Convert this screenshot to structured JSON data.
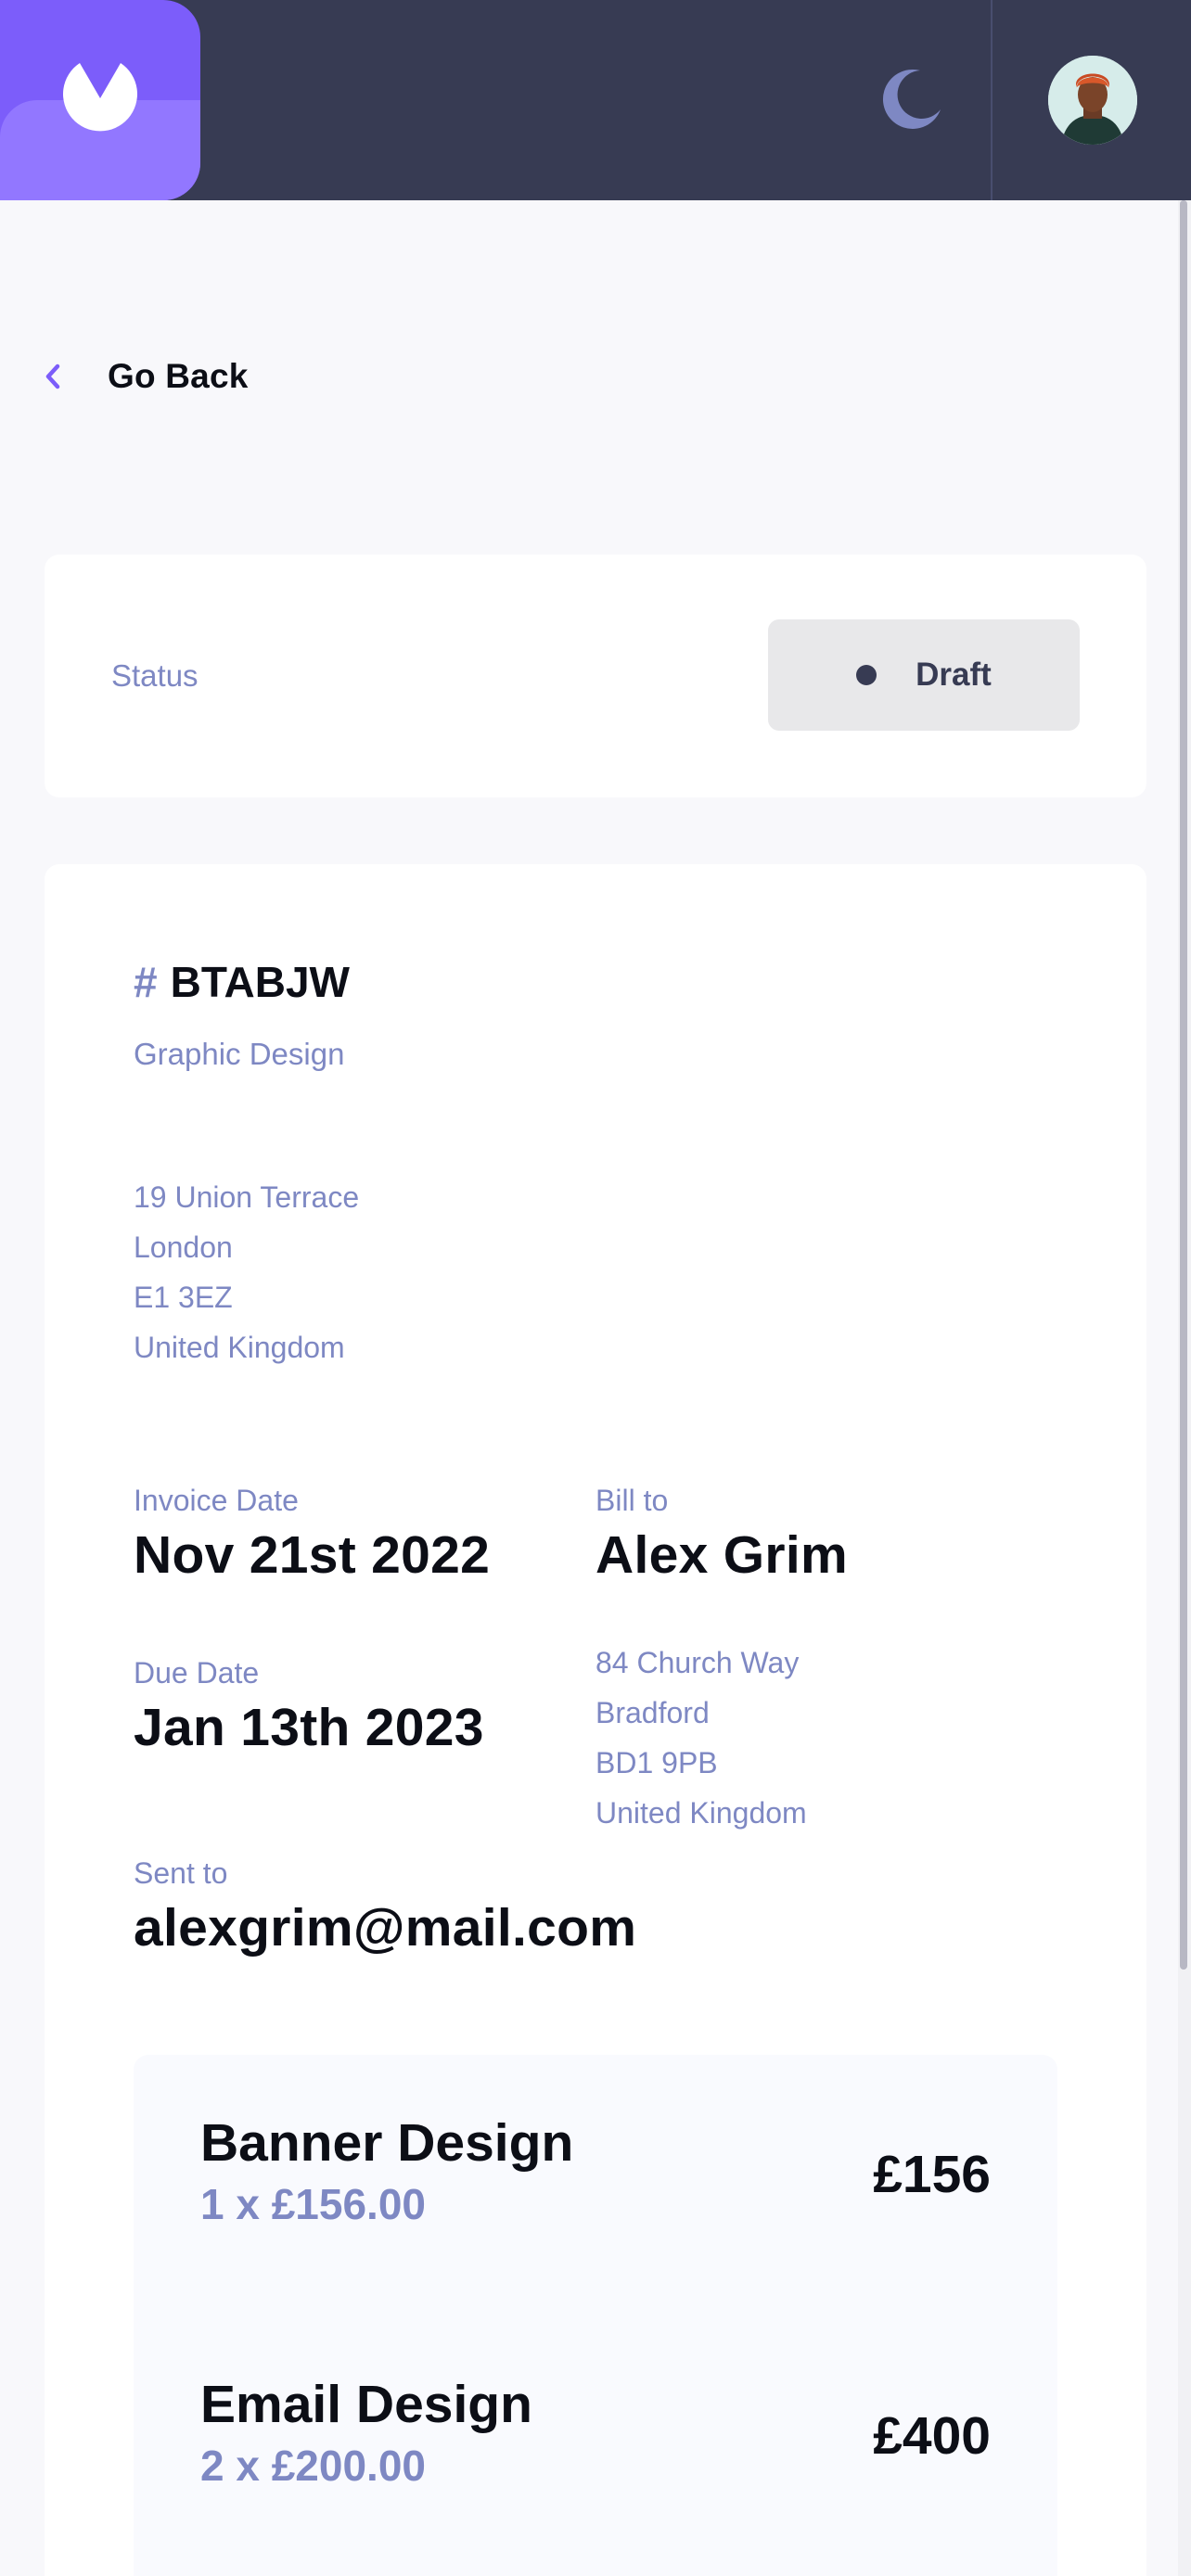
{
  "header": {
    "logo_icon": "brand-logo",
    "theme_toggle_icon": "moon-icon",
    "avatar_icon": "user-avatar",
    "colors": {
      "header_bg": "#373b53",
      "brand": "#7c5dfa",
      "brand_light": "#9277ff"
    }
  },
  "navigation": {
    "back_label": "Go Back"
  },
  "status": {
    "label": "Status",
    "value": "Draft",
    "color": "#373b53"
  },
  "invoice": {
    "id_hash": "#",
    "id": "BTABJW",
    "description": "Graphic Design",
    "sender_address": {
      "street": "19 Union Terrace",
      "city": "London",
      "post_code": "E1 3EZ",
      "country": "United Kingdom"
    },
    "invoice_date_label": "Invoice Date",
    "invoice_date": "Nov 21st 2022",
    "due_date_label": "Due Date",
    "due_date": "Jan 13th 2023",
    "bill_to_label": "Bill to",
    "client_name": "Alex Grim",
    "client_address": {
      "street": "84 Church Way",
      "city": "Bradford",
      "post_code": "BD1 9PB",
      "country": "United Kingdom"
    },
    "sent_to_label": "Sent to",
    "client_email": "alexgrim@mail.com",
    "items": [
      {
        "name": "Banner Design",
        "qty_price": "1 x £156.00",
        "total": "£156"
      },
      {
        "name": "Email Design",
        "qty_price": "2 x £200.00",
        "total": "£400"
      }
    ]
  }
}
